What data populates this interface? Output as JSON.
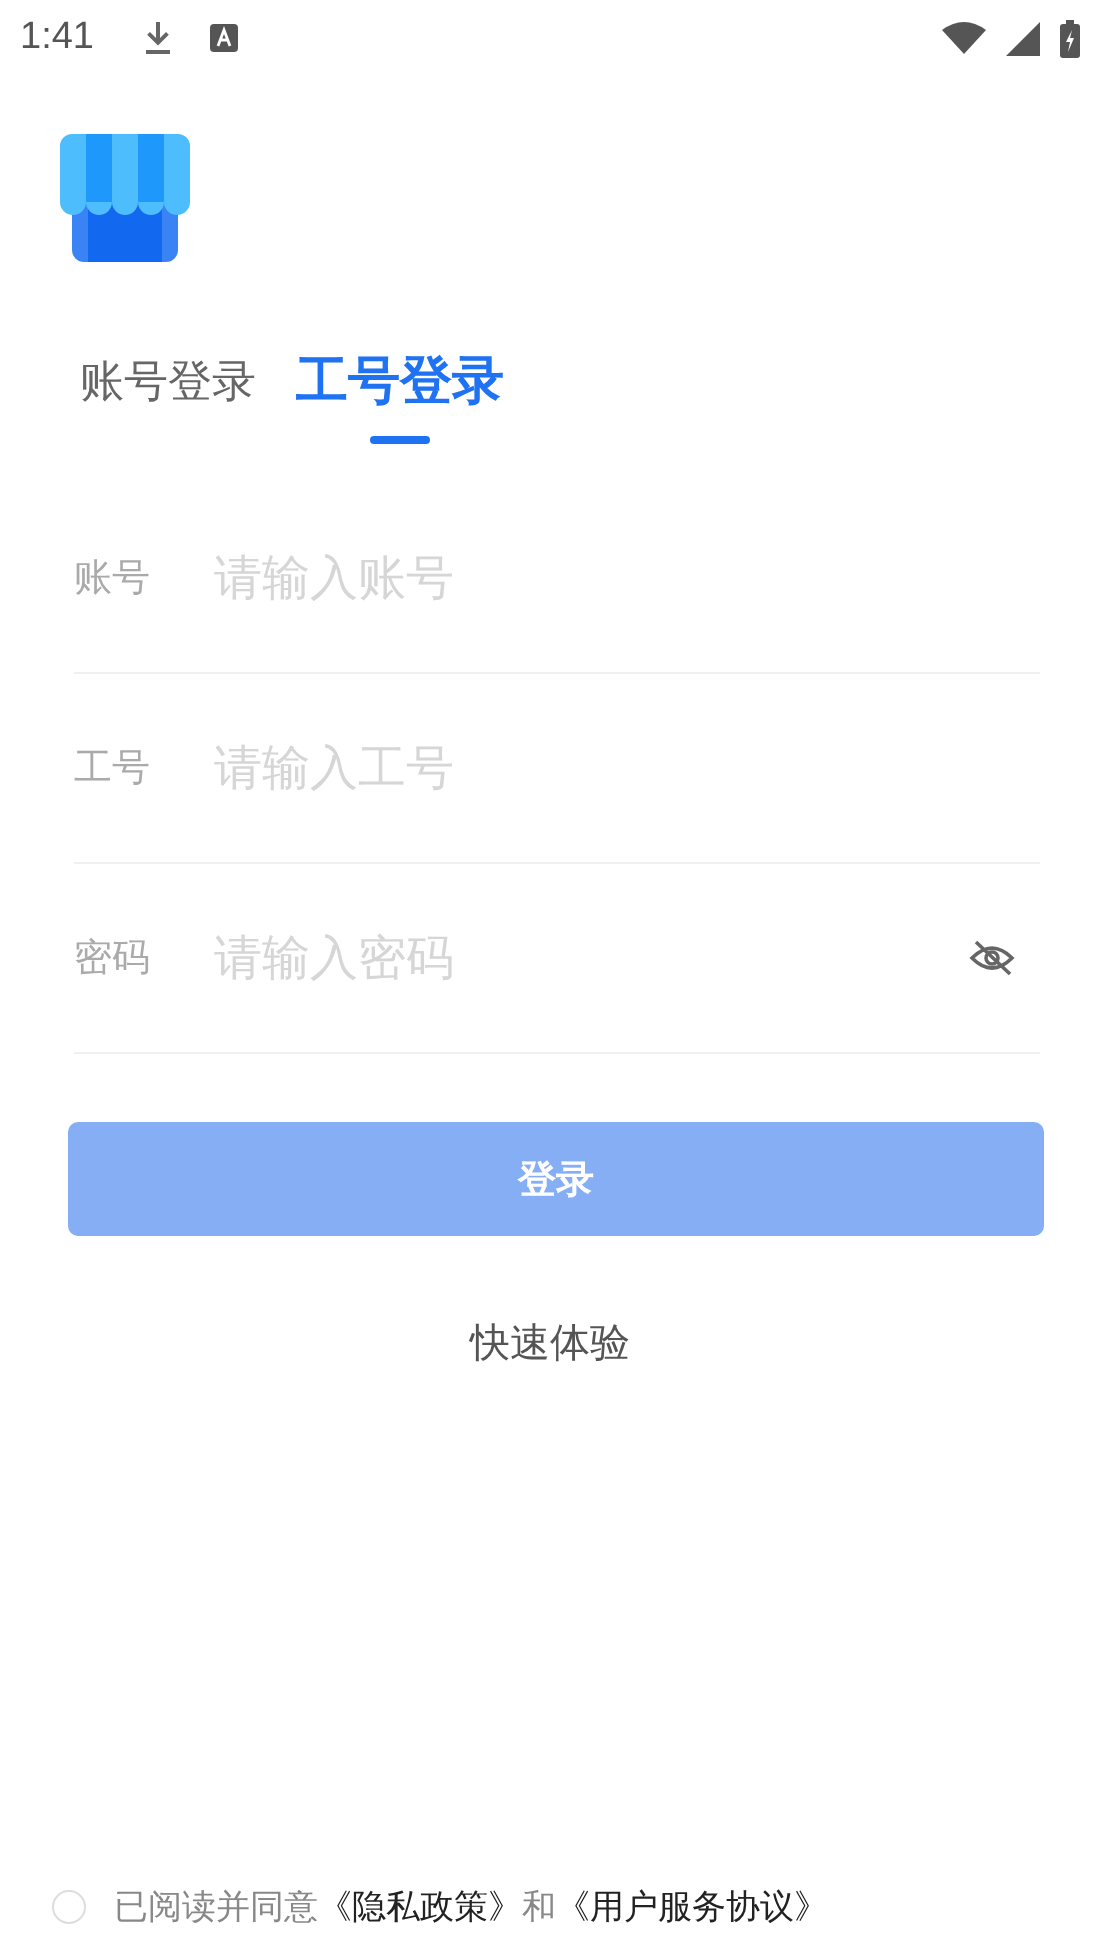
{
  "status_bar": {
    "time": "1:41"
  },
  "tabs": [
    {
      "label": "账号登录",
      "selected": false
    },
    {
      "label": "工号登录",
      "selected": true
    }
  ],
  "fields": [
    {
      "label": "账号",
      "placeholder": "请输入账号",
      "kind": "text"
    },
    {
      "label": "工号",
      "placeholder": "请输入工号",
      "kind": "text"
    },
    {
      "label": "密码",
      "placeholder": "请输入密码",
      "kind": "password"
    }
  ],
  "login_button": {
    "label": "登录",
    "disabled": true
  },
  "quick_link": "快速体验",
  "agreement": {
    "checked": false,
    "prefix": "已阅读并同意",
    "links": [
      "《隐私政策》",
      "《用户服务协议》"
    ],
    "joiner": "和"
  }
}
